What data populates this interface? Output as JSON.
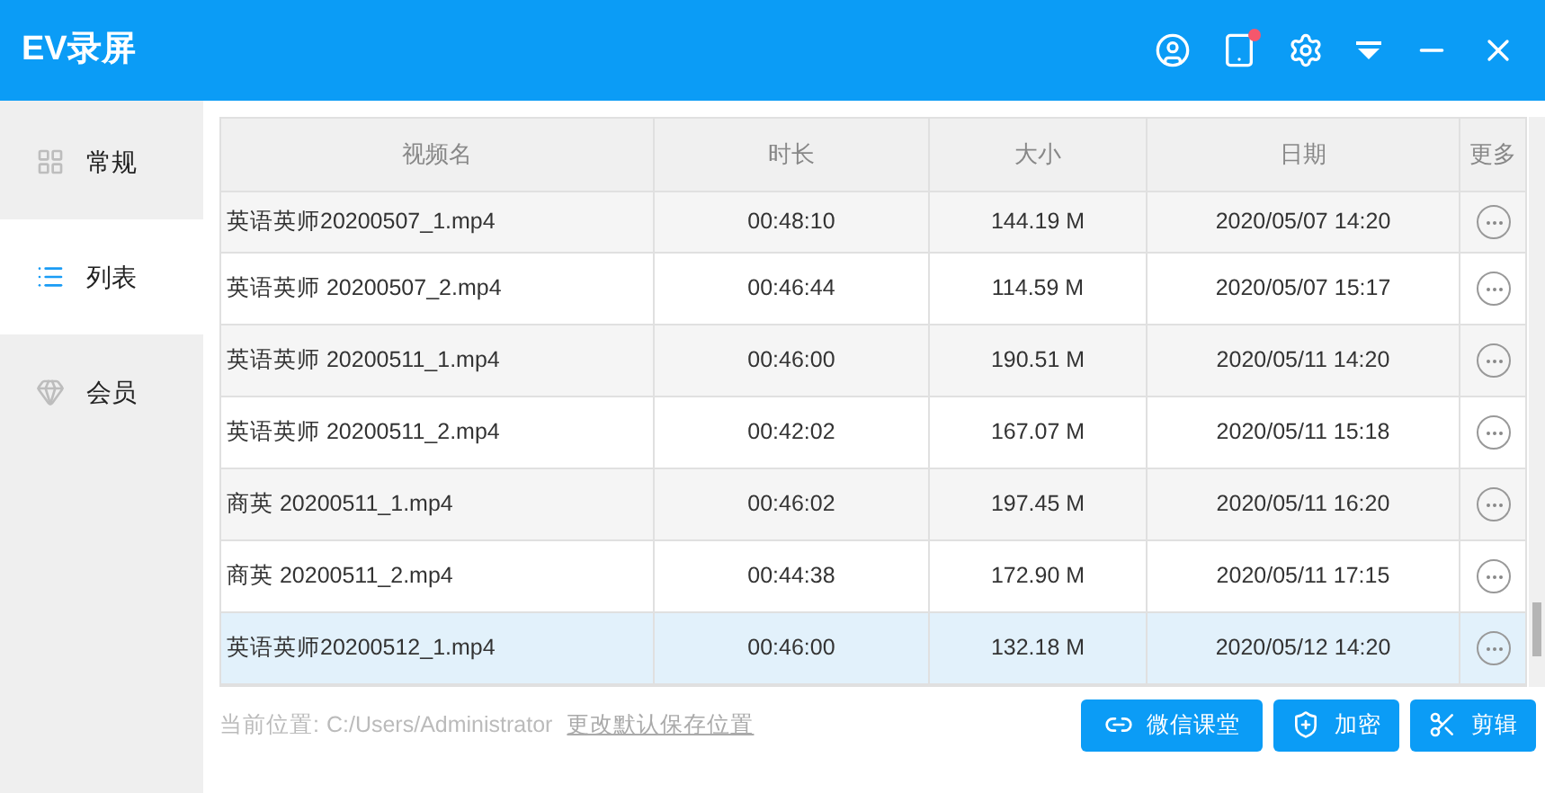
{
  "window": {
    "title": "EV录屏"
  },
  "sidebar": {
    "items": [
      {
        "label": "常规",
        "kind": "grid",
        "selected": false
      },
      {
        "label": "列表",
        "kind": "list",
        "selected": true
      },
      {
        "label": "会员",
        "kind": "gem",
        "selected": false
      }
    ]
  },
  "table": {
    "columns": [
      "视频名",
      "时长",
      "大小",
      "日期",
      "更多"
    ],
    "rows": [
      {
        "name": "英语英师20200507_1.mp4",
        "duration": "00:48:10",
        "size": "144.19 M",
        "date": "2020/05/07 14:20",
        "selected": false
      },
      {
        "name": "英语英师 20200507_2.mp4",
        "duration": "00:46:44",
        "size": "114.59 M",
        "date": "2020/05/07 15:17",
        "selected": false
      },
      {
        "name": "英语英师 20200511_1.mp4",
        "duration": "00:46:00",
        "size": "190.51 M",
        "date": "2020/05/11 14:20",
        "selected": false
      },
      {
        "name": "英语英师 20200511_2.mp4",
        "duration": "00:42:02",
        "size": "167.07 M",
        "date": "2020/05/11 15:18",
        "selected": false
      },
      {
        "name": "商英 20200511_1.mp4",
        "duration": "00:46:02",
        "size": "197.45 M",
        "date": "2020/05/11 16:20",
        "selected": false
      },
      {
        "name": "商英 20200511_2.mp4",
        "duration": "00:44:38",
        "size": "172.90 M",
        "date": "2020/05/11 17:15",
        "selected": false
      },
      {
        "name": "英语英师20200512_1.mp4",
        "duration": "00:46:00",
        "size": "132.18 M",
        "date": "2020/05/12 14:20",
        "selected": true
      }
    ]
  },
  "status_bar": {
    "label": "当前位置:",
    "path": "C:/Users/Administrator",
    "link": "更改默认保存位置"
  },
  "buttons": [
    {
      "label": "微信课堂",
      "kind": "link"
    },
    {
      "label": "加密",
      "kind": "shield"
    },
    {
      "label": "剪辑",
      "kind": "scissors"
    }
  ]
}
